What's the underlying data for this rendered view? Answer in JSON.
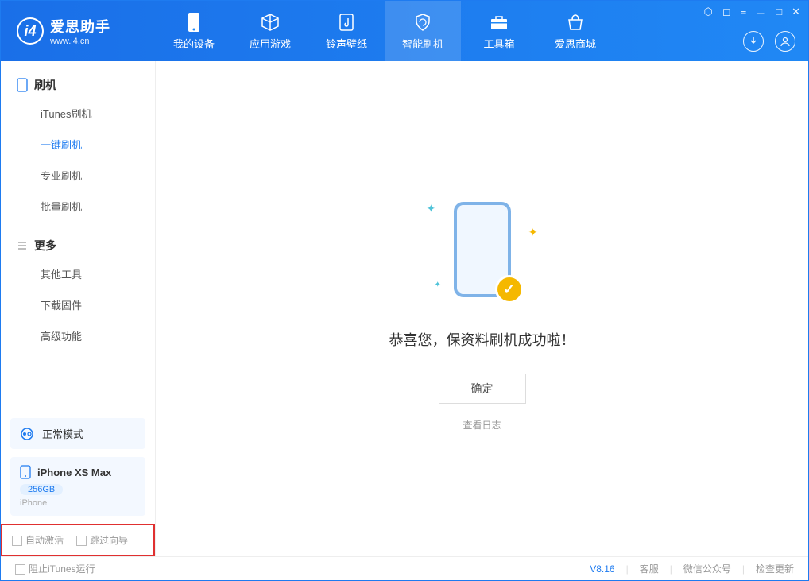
{
  "app": {
    "title": "爱思助手",
    "subtitle": "www.i4.cn"
  },
  "nav": {
    "tabs": [
      {
        "label": "我的设备"
      },
      {
        "label": "应用游戏"
      },
      {
        "label": "铃声壁纸"
      },
      {
        "label": "智能刷机"
      },
      {
        "label": "工具箱"
      },
      {
        "label": "爱思商城"
      }
    ]
  },
  "sidebar": {
    "group1_title": "刷机",
    "group1_items": [
      {
        "label": "iTunes刷机"
      },
      {
        "label": "一键刷机"
      },
      {
        "label": "专业刷机"
      },
      {
        "label": "批量刷机"
      }
    ],
    "group2_title": "更多",
    "group2_items": [
      {
        "label": "其他工具"
      },
      {
        "label": "下载固件"
      },
      {
        "label": "高级功能"
      }
    ],
    "mode_label": "正常模式",
    "device_name": "iPhone XS Max",
    "device_capacity": "256GB",
    "device_type": "iPhone",
    "check_auto_activate": "自动激活",
    "check_skip_guide": "跳过向导"
  },
  "main": {
    "success_text": "恭喜您，保资料刷机成功啦！",
    "ok_button": "确定",
    "view_log": "查看日志"
  },
  "statusbar": {
    "block_itunes": "阻止iTunes运行",
    "version": "V8.16",
    "customer_service": "客服",
    "wechat": "微信公众号",
    "check_update": "检查更新"
  }
}
